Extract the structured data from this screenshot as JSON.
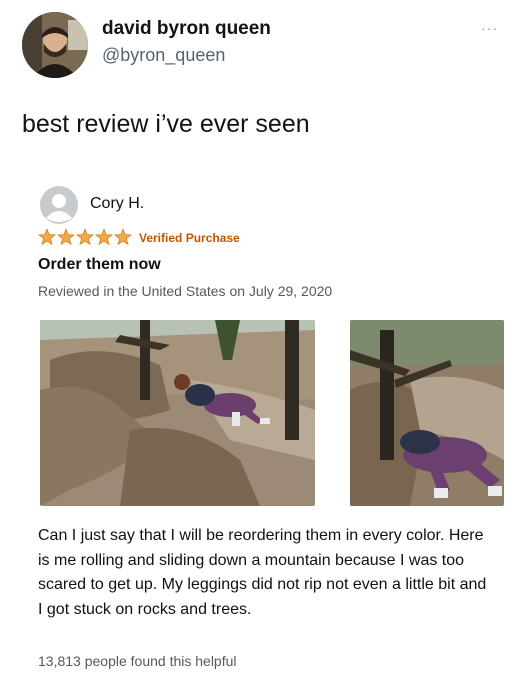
{
  "tweet": {
    "display_name": "david byron queen",
    "handle": "@byron_queen",
    "more_label": "···",
    "text": "best review i’ve ever seen"
  },
  "review": {
    "reviewer_name": "Cory H.",
    "rating": 5,
    "rating_max": 5,
    "verified_label": "Verified Purchase",
    "title": "Order them now",
    "date_line": "Reviewed in the United States on July 29, 2020",
    "body": "Can I just say that I will be reordering them in every color. Here is me rolling and sliding down a mountain because I was too scared to get up. My leggings did not rip not even a little bit and I got stuck on rocks and trees.",
    "helpful_text": "13,813 people found this helpful"
  },
  "colors": {
    "star": "#f3a847",
    "verified": "#c45500",
    "handle": "#536471"
  }
}
